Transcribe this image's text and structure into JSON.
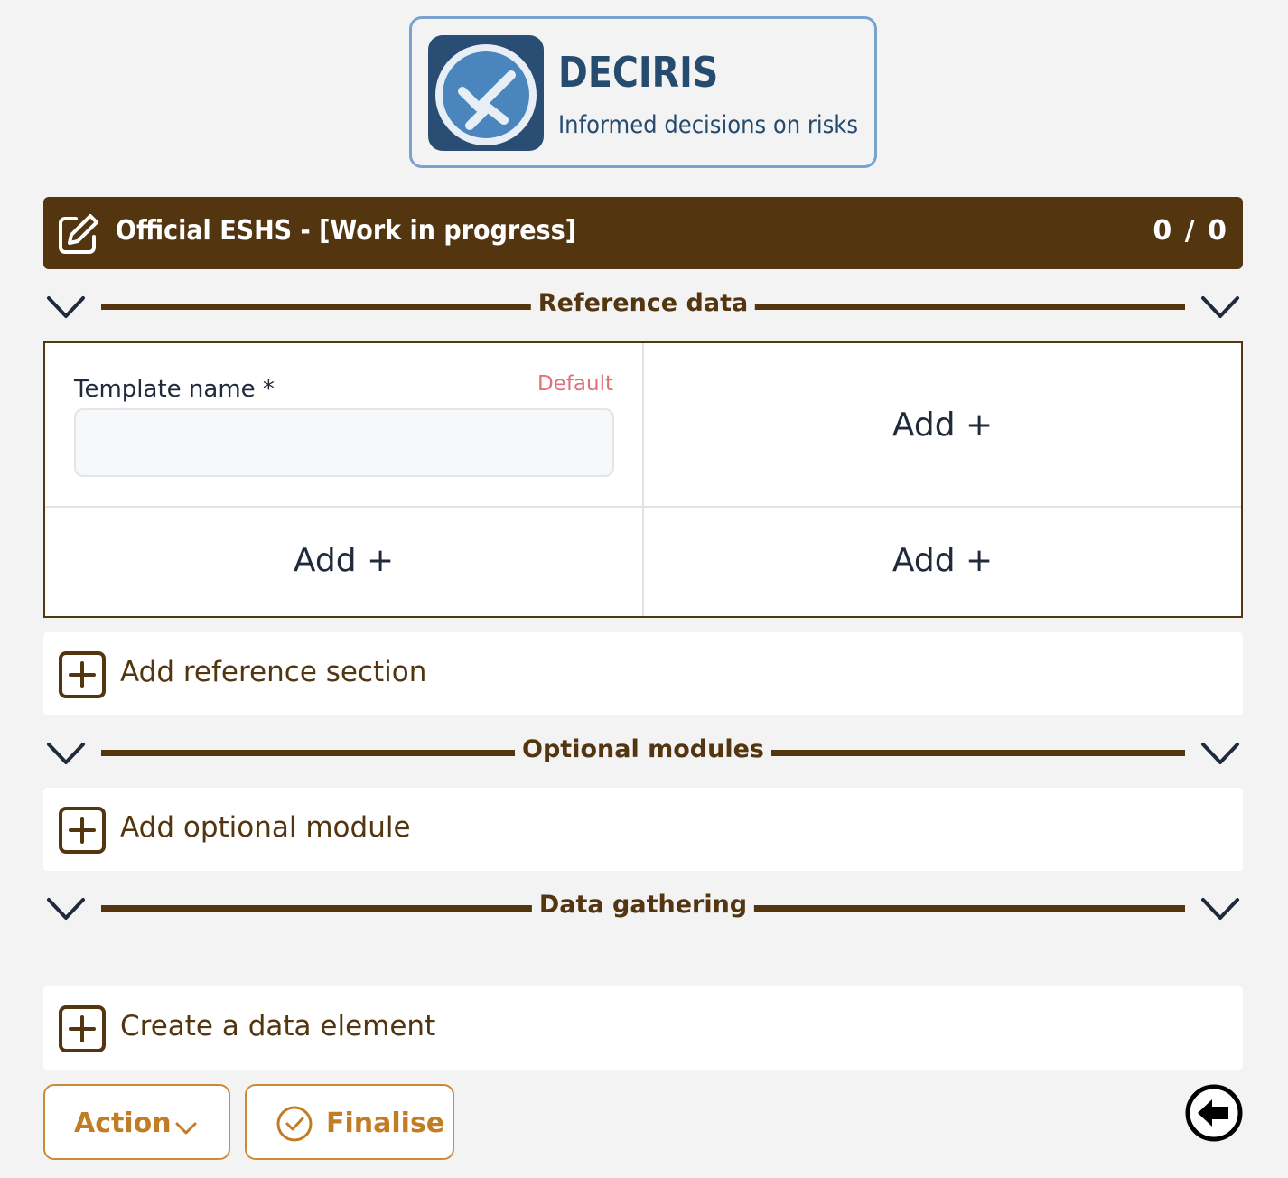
{
  "logo": {
    "title": "DECIRIS",
    "subtitle": "Informed decisions on risks"
  },
  "header": {
    "icon": "edit-icon",
    "title": "Official ESHS - [Work in progress]",
    "count": "0 / 0"
  },
  "sections": {
    "reference": "Reference data",
    "optional": "Optional modules",
    "gathering": "Data gathering"
  },
  "grid": {
    "template_field": {
      "label": "Template name *",
      "badge": "Default",
      "value": "",
      "placeholder": ""
    },
    "add_label": "Add +"
  },
  "rows": {
    "add_reference": "Add reference section",
    "add_optional": "Add optional module",
    "create_data": "Create a data element"
  },
  "footer": {
    "action_label": "Action",
    "finalise_label": "Finalise"
  },
  "colors": {
    "brown": "#533510",
    "accent": "#c27d24",
    "logo_blue": "#254b6f",
    "default_red": "#e0707a"
  }
}
